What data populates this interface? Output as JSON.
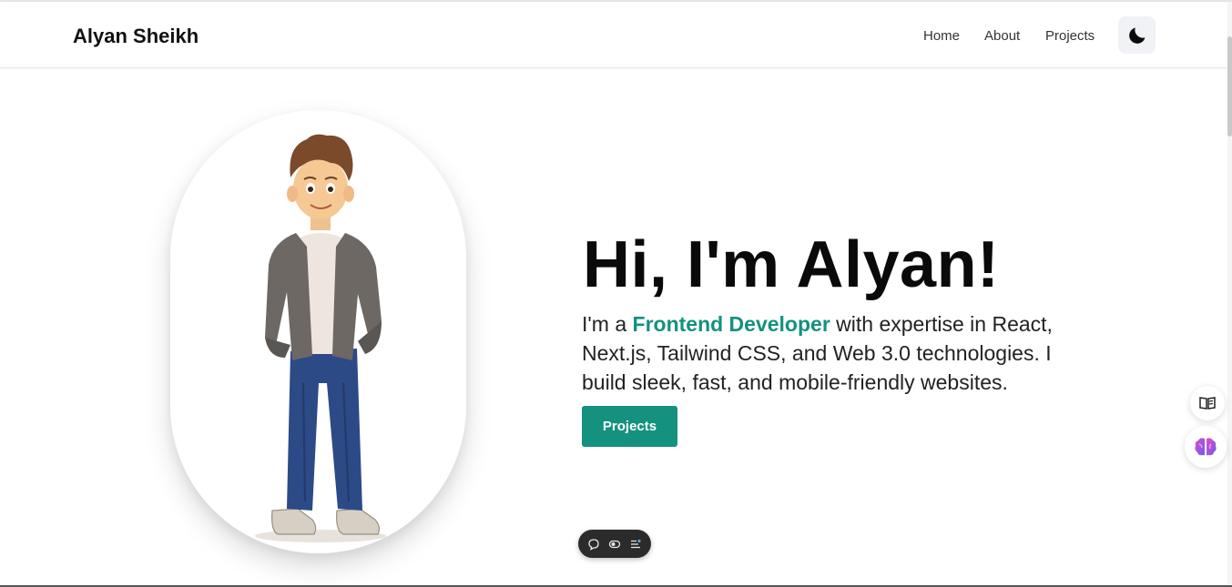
{
  "header": {
    "brand": "Alyan Sheikh",
    "nav": [
      "Home",
      "About",
      "Projects"
    ],
    "theme_toggle_icon": "moon-icon"
  },
  "hero": {
    "title": "Hi, I'm Alyan!",
    "desc_prefix": "I'm a ",
    "desc_highlight": "Frontend Developer",
    "desc_suffix": " with expertise in React, Next.js, Tailwind CSS, and Web 3.0 technologies. I build sleek, fast, and mobile-friendly websites.",
    "button_label": "Projects",
    "accent_color": "#14917f"
  },
  "floating_buttons": [
    "book-reader-icon",
    "brain-icon"
  ],
  "bottom_toolbar": [
    "comment-icon",
    "toggle-icon",
    "settings-list-icon"
  ]
}
